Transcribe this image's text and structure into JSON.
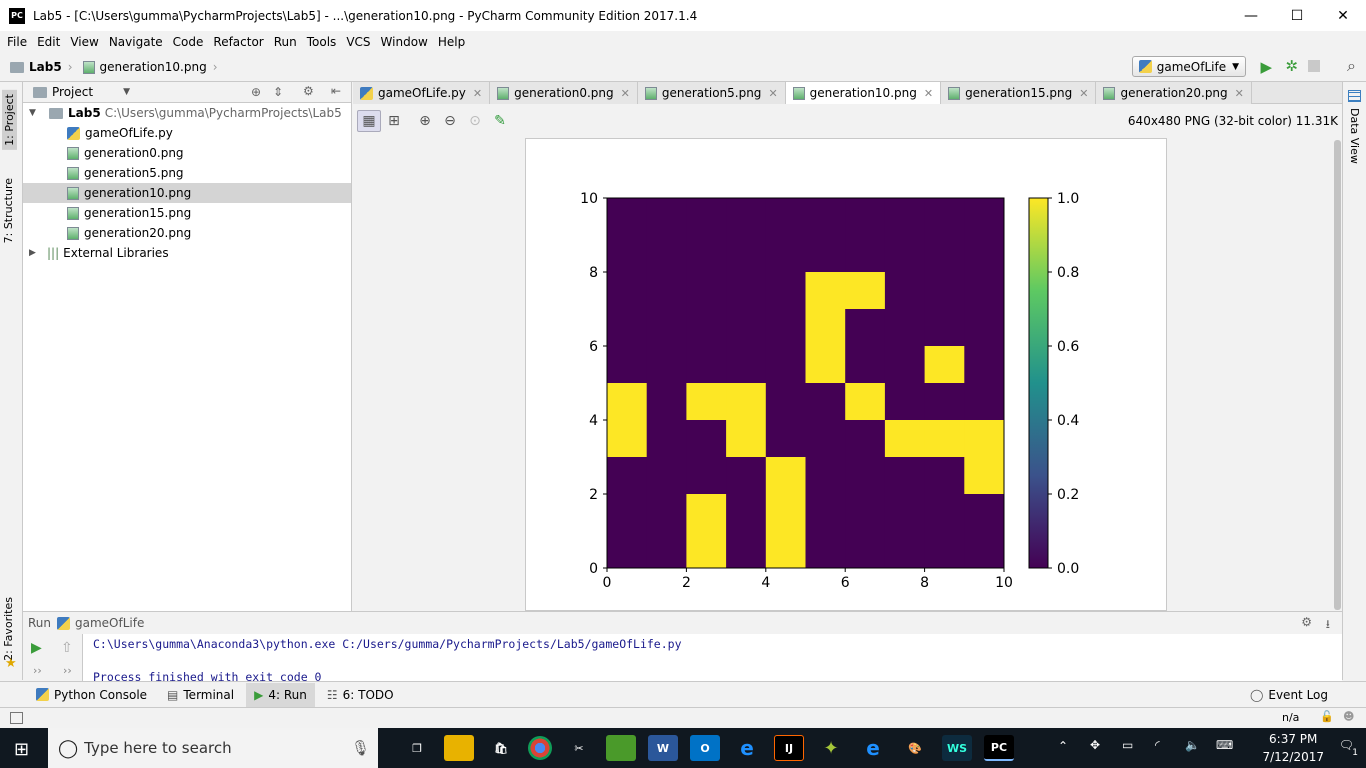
{
  "window": {
    "title": "Lab5 - [C:\\Users\\gumma\\PycharmProjects\\Lab5] - ...\\generation10.png - PyCharm Community Edition 2017.1.4",
    "app_icon": "PC"
  },
  "menu": [
    "File",
    "Edit",
    "View",
    "Navigate",
    "Code",
    "Refactor",
    "Run",
    "Tools",
    "VCS",
    "Window",
    "Help"
  ],
  "breadcrumb": {
    "project": "Lab5",
    "file": "generation10.png"
  },
  "run_config": "gameOfLife",
  "left_stripe": {
    "project": "1: Project",
    "structure": "7: Structure",
    "favorites": "2: Favorites"
  },
  "right_stripe": {
    "data_view": "Data View"
  },
  "project_panel": {
    "header": "Project",
    "root": {
      "name": "Lab5",
      "path": "C:\\Users\\gumma\\PycharmProjects\\Lab5"
    },
    "files": [
      "gameOfLife.py",
      "generation0.png",
      "generation5.png",
      "generation10.png",
      "generation15.png",
      "generation20.png"
    ],
    "external": "External Libraries"
  },
  "tabs": [
    "gameOfLife.py",
    "generation0.png",
    "generation5.png",
    "generation10.png",
    "generation15.png",
    "generation20.png"
  ],
  "image_info": "640x480 PNG (32-bit color) 11.31K",
  "run_panel": {
    "label": "Run",
    "config": "gameOfLife",
    "line1": "C:\\Users\\gumma\\Anaconda3\\python.exe C:/Users/gumma/PycharmProjects/Lab5/gameOfLife.py",
    "line2": "Process finished with exit code 0"
  },
  "bottom_tabs": {
    "python_console": "Python Console",
    "terminal": "Terminal",
    "run": "4: Run",
    "todo": "6: TODO",
    "event_log": "Event Log"
  },
  "status": {
    "position": "n/a"
  },
  "taskbar": {
    "search_placeholder": "Type here to search",
    "time": "6:37 PM",
    "date": "7/12/2017",
    "notifications": "1"
  },
  "chart_data": {
    "type": "heatmap",
    "xlim": [
      0,
      10
    ],
    "ylim": [
      0,
      10
    ],
    "x_ticks": [
      "0",
      "2",
      "4",
      "6",
      "8",
      "10"
    ],
    "y_ticks": [
      "0",
      "2",
      "4",
      "6",
      "8",
      "10"
    ],
    "colorbar_ticks": [
      "0.0",
      "0.2",
      "0.4",
      "0.6",
      "0.8",
      "1.0"
    ],
    "colors": {
      "off": "#440154",
      "on": "#fde725"
    },
    "grid_rows_top_to_bottom": [
      [
        0,
        0,
        0,
        0,
        0,
        0,
        0,
        0,
        0,
        0
      ],
      [
        0,
        0,
        0,
        0,
        0,
        0,
        0,
        0,
        0,
        0
      ],
      [
        0,
        0,
        0,
        0,
        0,
        1,
        1,
        0,
        0,
        0
      ],
      [
        0,
        0,
        0,
        0,
        0,
        1,
        0,
        0,
        0,
        0
      ],
      [
        0,
        0,
        0,
        0,
        0,
        1,
        0,
        0,
        1,
        0
      ],
      [
        1,
        0,
        1,
        1,
        0,
        0,
        1,
        0,
        0,
        0
      ],
      [
        1,
        0,
        0,
        1,
        0,
        0,
        0,
        1,
        1,
        1
      ],
      [
        0,
        0,
        0,
        0,
        1,
        0,
        0,
        0,
        0,
        1
      ],
      [
        0,
        0,
        1,
        0,
        1,
        0,
        0,
        0,
        0,
        0
      ],
      [
        0,
        0,
        1,
        0,
        1,
        0,
        0,
        0,
        0,
        0
      ]
    ]
  }
}
